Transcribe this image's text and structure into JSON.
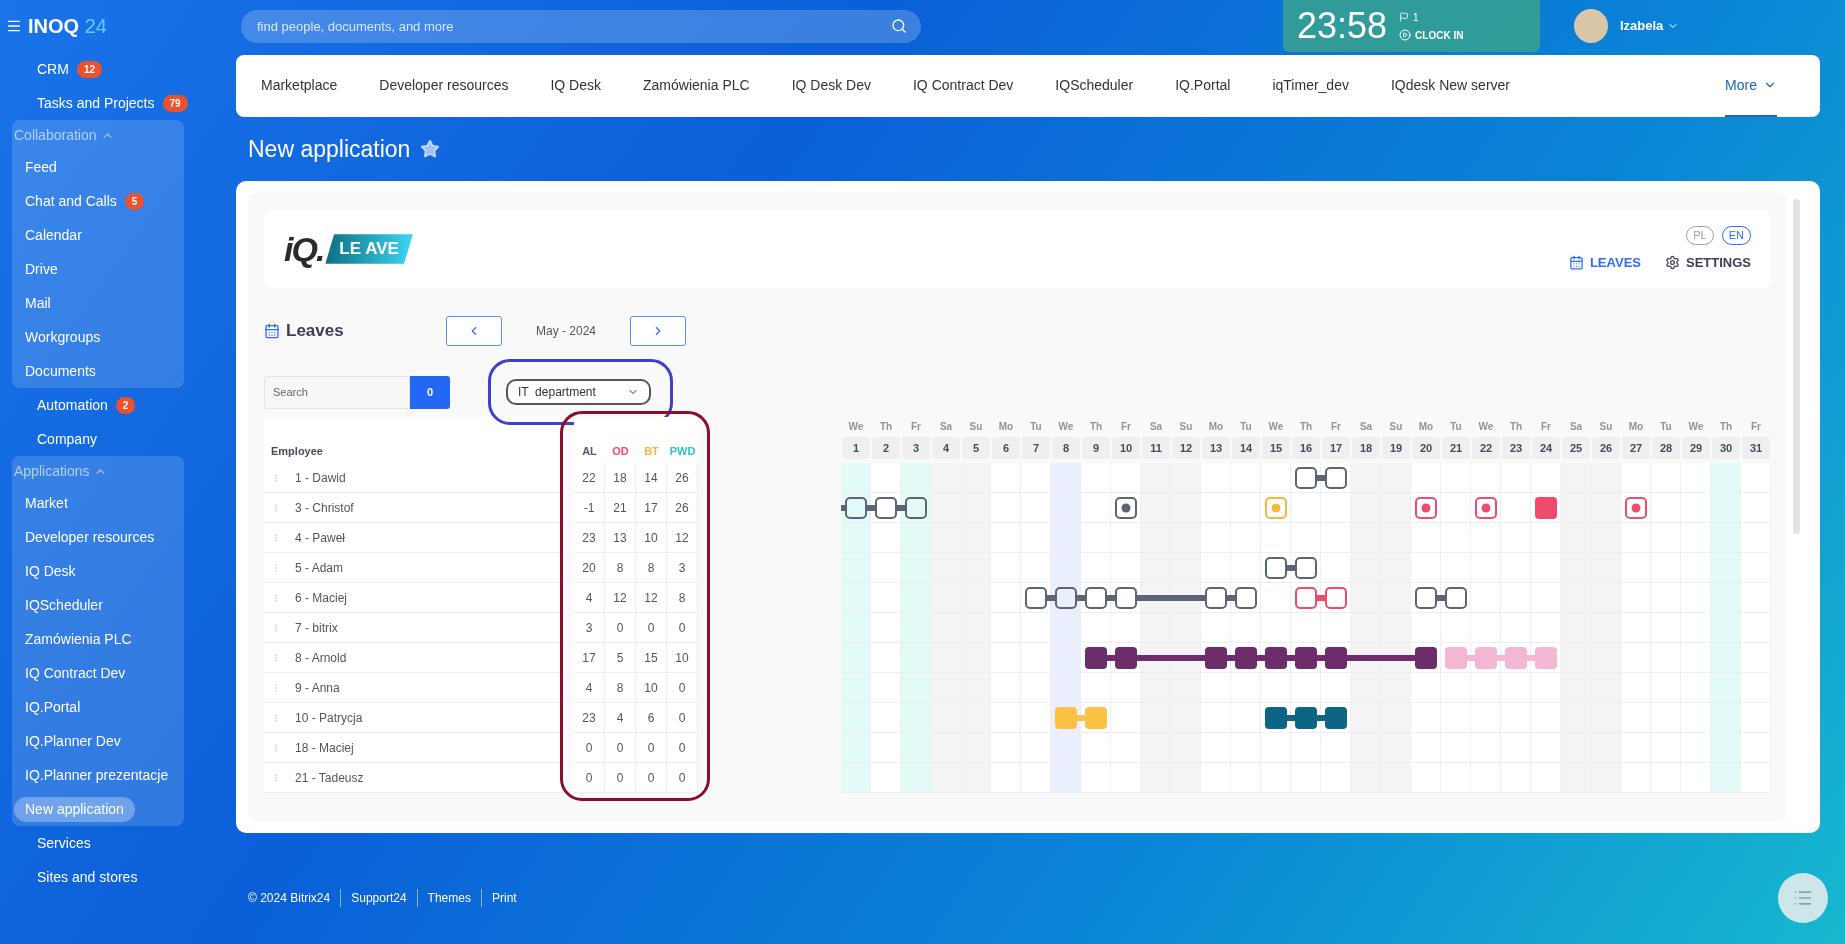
{
  "brand": {
    "name": "INOQ",
    "number": "24"
  },
  "search": {
    "placeholder": "find people, documents, and more"
  },
  "clock": {
    "time": "23:58",
    "flag_count": "1",
    "action": "CLOCK IN"
  },
  "user": {
    "name": "Izabela"
  },
  "sidebar": [
    {
      "kind": "item",
      "label": "CRM",
      "badge": "12",
      "selected": false
    },
    {
      "kind": "item",
      "label": "Tasks and Projects",
      "badge": "79",
      "selected": false
    },
    {
      "kind": "group",
      "title": "Collaboration",
      "expanded": true,
      "items": [
        {
          "label": "Feed",
          "selected": false
        },
        {
          "label": "Chat and Calls",
          "badge": "5",
          "selected": false
        },
        {
          "label": "Calendar",
          "selected": false
        },
        {
          "label": "Drive",
          "selected": false
        },
        {
          "label": "Mail",
          "selected": false
        },
        {
          "label": "Workgroups",
          "selected": false
        },
        {
          "label": "Documents",
          "selected": false
        }
      ]
    },
    {
      "kind": "item",
      "label": "Automation",
      "badge": "2",
      "selected": false
    },
    {
      "kind": "item",
      "label": "Company",
      "selected": false
    },
    {
      "kind": "group",
      "title": "Applications",
      "expanded": true,
      "items": [
        {
          "label": "Market",
          "selected": false
        },
        {
          "label": "Developer resources",
          "selected": false
        },
        {
          "label": "IQ Desk",
          "selected": false
        },
        {
          "label": "IQScheduler",
          "selected": false
        },
        {
          "label": "Zamówienia PLC",
          "selected": false
        },
        {
          "label": "IQ Contract Dev",
          "selected": false
        },
        {
          "label": "IQ.Portal",
          "selected": false
        },
        {
          "label": "IQ.Planner Dev",
          "selected": false
        },
        {
          "label": "IQ.Planner prezentacje",
          "selected": false
        },
        {
          "label": "New application",
          "selected": true
        }
      ]
    },
    {
      "kind": "item",
      "label": "Services",
      "selected": false
    },
    {
      "kind": "item",
      "label": "Sites and stores",
      "selected": false
    }
  ],
  "top_nav": {
    "tabs": [
      {
        "label": "Marketplace",
        "selected": false
      },
      {
        "label": "Developer resources",
        "selected": false
      },
      {
        "label": "IQ Desk",
        "selected": false
      },
      {
        "label": "Zamówienia PLC",
        "selected": false
      },
      {
        "label": "IQ Desk Dev",
        "selected": false
      },
      {
        "label": "IQ Contract Dev",
        "selected": false
      },
      {
        "label": "IQScheduler",
        "selected": false
      },
      {
        "label": "IQ.Portal",
        "selected": false
      },
      {
        "label": "iqTimer_dev",
        "selected": false
      },
      {
        "label": "IQdesk New server",
        "selected": false
      }
    ],
    "more": {
      "label": "More",
      "selected": true
    }
  },
  "page_title": "New application",
  "app": {
    "logo": {
      "mark": "iQ.",
      "banner": "LE AVE"
    },
    "languages": [
      {
        "label": "PL",
        "selected": false
      },
      {
        "label": "EN",
        "selected": true
      }
    ],
    "menu": [
      {
        "label": "LEAVES",
        "kind": "calendar",
        "selected": true
      },
      {
        "label": "SETTINGS",
        "kind": "gear",
        "selected": false
      }
    ],
    "section_title": "Leaves",
    "period": "May - 2024",
    "search": {
      "placeholder": "Search",
      "count": "0"
    },
    "department": {
      "value": "IT  department"
    },
    "table": {
      "employee_header": "Employee",
      "stat_columns": [
        {
          "label": "AL",
          "color": "#535c69"
        },
        {
          "label": "OD",
          "color": "#ef4b6e"
        },
        {
          "label": "BT",
          "color": "#f6b73c"
        },
        {
          "label": "PWD",
          "color": "#2cc4c4"
        }
      ],
      "days": [
        {
          "dow": "We",
          "day": "1",
          "kind": "holiday"
        },
        {
          "dow": "Th",
          "day": "2",
          "kind": "workday"
        },
        {
          "dow": "Fr",
          "day": "3",
          "kind": "holiday"
        },
        {
          "dow": "Sa",
          "day": "4",
          "kind": "weekend"
        },
        {
          "dow": "Su",
          "day": "5",
          "kind": "weekend"
        },
        {
          "dow": "Mo",
          "day": "6",
          "kind": "workday"
        },
        {
          "dow": "Tu",
          "day": "7",
          "kind": "workday"
        },
        {
          "dow": "We",
          "day": "8",
          "kind": "today"
        },
        {
          "dow": "Th",
          "day": "9",
          "kind": "workday"
        },
        {
          "dow": "Fr",
          "day": "10",
          "kind": "workday"
        },
        {
          "dow": "Sa",
          "day": "11",
          "kind": "weekend"
        },
        {
          "dow": "Su",
          "day": "12",
          "kind": "weekend"
        },
        {
          "dow": "Mo",
          "day": "13",
          "kind": "workday"
        },
        {
          "dow": "Tu",
          "day": "14",
          "kind": "workday"
        },
        {
          "dow": "We",
          "day": "15",
          "kind": "workday"
        },
        {
          "dow": "Th",
          "day": "16",
          "kind": "workday"
        },
        {
          "dow": "Fr",
          "day": "17",
          "kind": "workday"
        },
        {
          "dow": "Sa",
          "day": "18",
          "kind": "weekend"
        },
        {
          "dow": "Su",
          "day": "19",
          "kind": "weekend"
        },
        {
          "dow": "Mo",
          "day": "20",
          "kind": "workday"
        },
        {
          "dow": "Tu",
          "day": "21",
          "kind": "workday"
        },
        {
          "dow": "We",
          "day": "22",
          "kind": "workday"
        },
        {
          "dow": "Th",
          "day": "23",
          "kind": "workday"
        },
        {
          "dow": "Fr",
          "day": "24",
          "kind": "workday"
        },
        {
          "dow": "Sa",
          "day": "25",
          "kind": "weekend"
        },
        {
          "dow": "Su",
          "day": "26",
          "kind": "weekend"
        },
        {
          "dow": "Mo",
          "day": "27",
          "kind": "workday"
        },
        {
          "dow": "Tu",
          "day": "28",
          "kind": "workday"
        },
        {
          "dow": "We",
          "day": "29",
          "kind": "workday"
        },
        {
          "dow": "Th",
          "day": "30",
          "kind": "holiday"
        },
        {
          "dow": "Fr",
          "day": "31",
          "kind": "workday"
        }
      ],
      "employees": [
        {
          "name": "1 - Dawid",
          "stats": [
            "22",
            "18",
            "14",
            "26"
          ],
          "leaves": [
            {
              "kind": "outline",
              "color": "#5d6475"
            }
          ]
        },
        {
          "name": "3 - Christof",
          "stats": [
            "-1",
            "21",
            "17",
            "26"
          ],
          "leaves": [
            {
              "kind": "outline",
              "color": "#5d6475",
              "lead_in": true
            },
            {
              "kind": "dot",
              "color": "#5d6475"
            },
            {
              "kind": "dot",
              "color": "#f6b73c"
            },
            {
              "kind": "dot",
              "color": "#ef4b6e"
            },
            {
              "kind": "dot",
              "color": "#ef4b6e"
            },
            {
              "kind": "filled",
              "color": "#ef4b6e"
            },
            {
              "kind": "dot",
              "color": "#ef4b6e"
            }
          ]
        },
        {
          "name": "4 - Paweł",
          "stats": [
            "23",
            "13",
            "10",
            "12"
          ]
        },
        {
          "name": "5 - Adam",
          "stats": [
            "20",
            "8",
            "8",
            "3"
          ],
          "leaves": [
            {
              "kind": "outline",
              "color": "#5d6475"
            }
          ]
        },
        {
          "name": "6 - Maciej",
          "stats": [
            "4",
            "12",
            "12",
            "8"
          ],
          "leaves": [
            {
              "kind": "outline",
              "color": "#5d6475"
            },
            {
              "kind": "outline",
              "color": "#ef4b6e"
            },
            {
              "kind": "outline",
              "color": "#5d6475"
            }
          ]
        },
        {
          "name": "7 - bitrix",
          "stats": [
            "3",
            "0",
            "0",
            "0"
          ]
        },
        {
          "name": "8 - Arnold",
          "stats": [
            "17",
            "5",
            "15",
            "10"
          ],
          "leaves": [
            {
              "kind": "filled",
              "color": "#6c2d6a"
            },
            {
              "kind": "filled",
              "color": "#f3b6d3"
            }
          ]
        },
        {
          "name": "9 - Anna",
          "stats": [
            "4",
            "8",
            "10",
            "0"
          ]
        },
        {
          "name": "10 - Patrycja",
          "stats": [
            "23",
            "4",
            "6",
            "0"
          ],
          "leaves": [
            {
              "kind": "filled",
              "color": "#fdc245"
            },
            {
              "kind": "filled",
              "color": "#0d6584"
            }
          ]
        },
        {
          "name": "18 - Maciej",
          "stats": [
            "0",
            "0",
            "0",
            "0"
          ]
        },
        {
          "name": "21 - Tadeusz",
          "stats": [
            "0",
            "0",
            "0",
            "0"
          ]
        }
      ]
    }
  },
  "footer": [
    "© 2024 Bitrix24",
    "Support24",
    "Themes",
    "Print"
  ]
}
